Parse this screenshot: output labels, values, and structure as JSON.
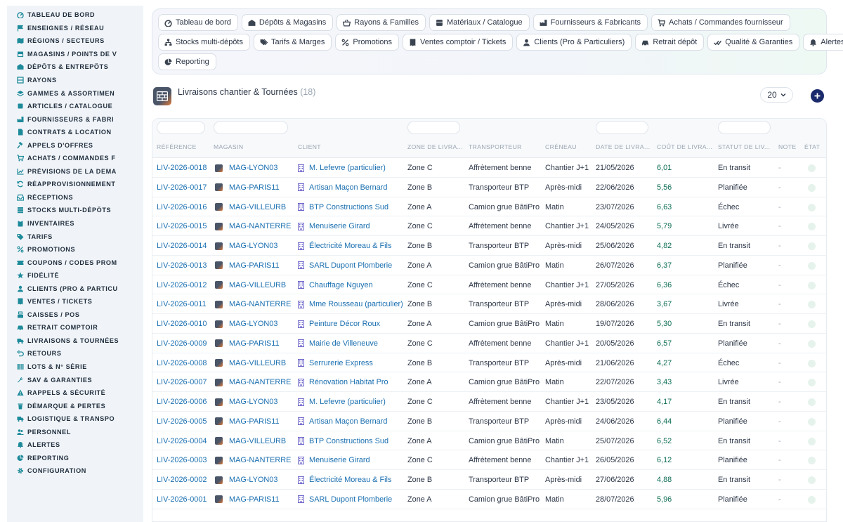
{
  "sidebar": {
    "items": [
      {
        "label": "TABLEAU DE BORD",
        "icon": "gauge-icon"
      },
      {
        "label": "ENSEIGNES / RÉSEAU",
        "icon": "flag-icon"
      },
      {
        "label": "RÉGIONS / SECTEURS",
        "icon": "map-icon"
      },
      {
        "label": "MAGASINS / POINTS DE V",
        "icon": "store-icon"
      },
      {
        "label": "DÉPÔTS & ENTREPÔTS",
        "icon": "warehouse-icon"
      },
      {
        "label": "RAYONS",
        "icon": "shelf-icon"
      },
      {
        "label": "GAMMES & ASSORTIMEN",
        "icon": "layers-icon"
      },
      {
        "label": "ARTICLES / CATALOGUE",
        "icon": "box-icon"
      },
      {
        "label": "FOURNISSEURS & FABRI",
        "icon": "factory-icon"
      },
      {
        "label": "CONTRATS & LOCATION",
        "icon": "file-icon"
      },
      {
        "label": "APPELS D'OFFRES",
        "icon": "gavel-icon"
      },
      {
        "label": "ACHATS / COMMANDES F",
        "icon": "cart-icon"
      },
      {
        "label": "PRÉVISIONS DE LA DEMA",
        "icon": "chart-icon"
      },
      {
        "label": "RÉAPPROVISIONNEMENT",
        "icon": "sync-icon"
      },
      {
        "label": "RÉCEPTIONS",
        "icon": "inbox-icon"
      },
      {
        "label": "STOCKS MULTI-DÉPÔTS",
        "icon": "stack-icon"
      },
      {
        "label": "INVENTAIRES",
        "icon": "clipboard-icon"
      },
      {
        "label": "TARIFS",
        "icon": "tag-icon"
      },
      {
        "label": "PROMOTIONS",
        "icon": "percent-icon"
      },
      {
        "label": "COUPONS / CODES PROM",
        "icon": "ticket-icon"
      },
      {
        "label": "FIDÉLITÉ",
        "icon": "star-icon"
      },
      {
        "label": "CLIENTS (PRO & PARTICU",
        "icon": "user-icon"
      },
      {
        "label": "VENTES / TICKETS",
        "icon": "receipt-icon"
      },
      {
        "label": "CAISSES / POS",
        "icon": "register-icon"
      },
      {
        "label": "RETRAIT COMPTOIR",
        "icon": "car-icon"
      },
      {
        "label": "LIVRAISONS & TOURNÉES",
        "icon": "truck-icon"
      },
      {
        "label": "RETOURS",
        "icon": "undo-icon"
      },
      {
        "label": "LOTS & N° SÉRIE",
        "icon": "barcode-icon"
      },
      {
        "label": "SAV & GARANTIES",
        "icon": "wrench-icon"
      },
      {
        "label": "RAPPELS & SÉCURITÉ",
        "icon": "warning-icon"
      },
      {
        "label": "DÉMARQUE & PERTES",
        "icon": "trash-icon"
      },
      {
        "label": "LOGISTIQUE & TRANSPO",
        "icon": "truck-icon"
      },
      {
        "label": "PERSONNEL",
        "icon": "users-icon"
      },
      {
        "label": "ALERTES",
        "icon": "bell-icon"
      },
      {
        "label": "REPORTING",
        "icon": "pie-icon"
      },
      {
        "label": "CONFIGURATION",
        "icon": "gear-icon"
      }
    ]
  },
  "nav": {
    "rows": [
      [
        {
          "label": "Tableau de bord",
          "icon": "gauge-icon"
        },
        {
          "label": "Dépôts & Magasins",
          "icon": "warehouse-icon"
        },
        {
          "label": "Rayons & Familles",
          "icon": "basket-icon"
        },
        {
          "label": "Matériaux / Catalogue",
          "icon": "catalog-icon"
        },
        {
          "label": "Fournisseurs & Fabricants",
          "icon": "factory-icon"
        },
        {
          "label": "Achats / Commandes fournisseur",
          "icon": "cart-icon"
        }
      ],
      [
        {
          "label": "Stocks multi-dépôts",
          "icon": "network-icon"
        },
        {
          "label": "Tarifs & Marges",
          "icon": "tags-icon"
        },
        {
          "label": "Promotions",
          "icon": "percent-icon"
        },
        {
          "label": "Ventes comptoir / Tickets",
          "icon": "receipt-icon"
        },
        {
          "label": "Clients (Pro & Particuliers)",
          "icon": "user-icon"
        },
        {
          "label": "Retrait dépôt",
          "icon": "car-icon"
        },
        {
          "label": "Qualité & Garanties",
          "icon": "check-double-icon"
        },
        {
          "label": "Alertes",
          "icon": "bell-icon"
        }
      ],
      [
        {
          "label": "Reporting",
          "icon": "pie-icon"
        }
      ]
    ]
  },
  "section": {
    "title": "Livraisons chantier & Tournées",
    "count": "(18)",
    "icon": "brick-wall-icon",
    "per_page": "20"
  },
  "table": {
    "headers": [
      "RÉFÉRENCE",
      "MAGASIN",
      "CLIENT",
      "ZONE DE LIVRA...",
      "TRANSPORTEUR",
      "CRÉNEAU",
      "DATE DE LIVRA...",
      "COÛT DE LIVRA...",
      "STATUT DE LIV...",
      "NOTE",
      "ÉTAT"
    ],
    "rows": [
      {
        "ref": "LIV-2026-0018",
        "mag": "MAG-LYON03",
        "client": "M. Lefevre (particulier)",
        "zone": "Zone C",
        "transp": "Affrètement benne",
        "creneau": "Chantier J+1",
        "date": "21/05/2026",
        "cout": "6,01",
        "statut": "En transit",
        "note": "-"
      },
      {
        "ref": "LIV-2026-0017",
        "mag": "MAG-PARIS11",
        "client": "Artisan Maçon Bernard",
        "zone": "Zone B",
        "transp": "Transporteur BTP",
        "creneau": "Après-midi",
        "date": "22/06/2026",
        "cout": "5,56",
        "statut": "Planifiée",
        "note": "-"
      },
      {
        "ref": "LIV-2026-0016",
        "mag": "MAG-VILLEURB",
        "client": "BTP Constructions Sud",
        "zone": "Zone A",
        "transp": "Camion grue BâtiPro",
        "creneau": "Matin",
        "date": "23/07/2026",
        "cout": "6,63",
        "statut": "Échec",
        "note": "-"
      },
      {
        "ref": "LIV-2026-0015",
        "mag": "MAG-NANTERRE",
        "client": "Menuiserie Girard",
        "zone": "Zone C",
        "transp": "Affrètement benne",
        "creneau": "Chantier J+1",
        "date": "24/05/2026",
        "cout": "5,79",
        "statut": "Livrée",
        "note": "-"
      },
      {
        "ref": "LIV-2026-0014",
        "mag": "MAG-LYON03",
        "client": "Électricité Moreau & Fils",
        "zone": "Zone B",
        "transp": "Transporteur BTP",
        "creneau": "Après-midi",
        "date": "25/06/2026",
        "cout": "4,82",
        "statut": "En transit",
        "note": "-"
      },
      {
        "ref": "LIV-2026-0013",
        "mag": "MAG-PARIS11",
        "client": "SARL Dupont Plomberie",
        "zone": "Zone A",
        "transp": "Camion grue BâtiPro",
        "creneau": "Matin",
        "date": "26/07/2026",
        "cout": "6,37",
        "statut": "Planifiée",
        "note": "-"
      },
      {
        "ref": "LIV-2026-0012",
        "mag": "MAG-VILLEURB",
        "client": "Chauffage Nguyen",
        "zone": "Zone C",
        "transp": "Affrètement benne",
        "creneau": "Chantier J+1",
        "date": "27/05/2026",
        "cout": "6,36",
        "statut": "Échec",
        "note": "-"
      },
      {
        "ref": "LIV-2026-0011",
        "mag": "MAG-NANTERRE",
        "client": "Mme Rousseau (particulier)",
        "zone": "Zone B",
        "transp": "Transporteur BTP",
        "creneau": "Après-midi",
        "date": "28/06/2026",
        "cout": "3,67",
        "statut": "Livrée",
        "note": "-"
      },
      {
        "ref": "LIV-2026-0010",
        "mag": "MAG-LYON03",
        "client": "Peinture Décor Roux",
        "zone": "Zone A",
        "transp": "Camion grue BâtiPro",
        "creneau": "Matin",
        "date": "19/07/2026",
        "cout": "5,30",
        "statut": "En transit",
        "note": "-"
      },
      {
        "ref": "LIV-2026-0009",
        "mag": "MAG-PARIS11",
        "client": "Mairie de Villeneuve",
        "zone": "Zone C",
        "transp": "Affrètement benne",
        "creneau": "Chantier J+1",
        "date": "20/05/2026",
        "cout": "6,57",
        "statut": "Planifiée",
        "note": "-"
      },
      {
        "ref": "LIV-2026-0008",
        "mag": "MAG-VILLEURB",
        "client": "Serrurerie Express",
        "zone": "Zone B",
        "transp": "Transporteur BTP",
        "creneau": "Après-midi",
        "date": "21/06/2026",
        "cout": "4,27",
        "statut": "Échec",
        "note": "-"
      },
      {
        "ref": "LIV-2026-0007",
        "mag": "MAG-NANTERRE",
        "client": "Rénovation Habitat Pro",
        "zone": "Zone A",
        "transp": "Camion grue BâtiPro",
        "creneau": "Matin",
        "date": "22/07/2026",
        "cout": "3,43",
        "statut": "Livrée",
        "note": "-"
      },
      {
        "ref": "LIV-2026-0006",
        "mag": "MAG-LYON03",
        "client": "M. Lefevre (particulier)",
        "zone": "Zone C",
        "transp": "Affrètement benne",
        "creneau": "Chantier J+1",
        "date": "23/05/2026",
        "cout": "4,17",
        "statut": "En transit",
        "note": "-"
      },
      {
        "ref": "LIV-2026-0005",
        "mag": "MAG-PARIS11",
        "client": "Artisan Maçon Bernard",
        "zone": "Zone B",
        "transp": "Transporteur BTP",
        "creneau": "Après-midi",
        "date": "24/06/2026",
        "cout": "6,44",
        "statut": "Planifiée",
        "note": "-"
      },
      {
        "ref": "LIV-2026-0004",
        "mag": "MAG-VILLEURB",
        "client": "BTP Constructions Sud",
        "zone": "Zone A",
        "transp": "Camion grue BâtiPro",
        "creneau": "Matin",
        "date": "25/07/2026",
        "cout": "6,52",
        "statut": "En transit",
        "note": "-"
      },
      {
        "ref": "LIV-2026-0003",
        "mag": "MAG-NANTERRE",
        "client": "Menuiserie Girard",
        "zone": "Zone C",
        "transp": "Affrètement benne",
        "creneau": "Chantier J+1",
        "date": "26/05/2026",
        "cout": "6,12",
        "statut": "Planifiée",
        "note": "-"
      },
      {
        "ref": "LIV-2026-0002",
        "mag": "MAG-LYON03",
        "client": "Électricité Moreau & Fils",
        "zone": "Zone B",
        "transp": "Transporteur BTP",
        "creneau": "Après-midi",
        "date": "27/06/2026",
        "cout": "4,88",
        "statut": "En transit",
        "note": "-"
      },
      {
        "ref": "LIV-2026-0001",
        "mag": "MAG-PARIS11",
        "client": "SARL Dupont Plomberie",
        "zone": "Zone A",
        "transp": "Camion grue BâtiPro",
        "creneau": "Matin",
        "date": "28/07/2026",
        "cout": "5,96",
        "statut": "Planifiée",
        "note": "-"
      }
    ]
  },
  "colors": {
    "link": "#1a6fb0",
    "cost": "#0f6e55",
    "sidebar_bg": "#f0f4f8",
    "sidebar_icon": "#1e8a9a",
    "add_button": "#1a2a6c"
  }
}
